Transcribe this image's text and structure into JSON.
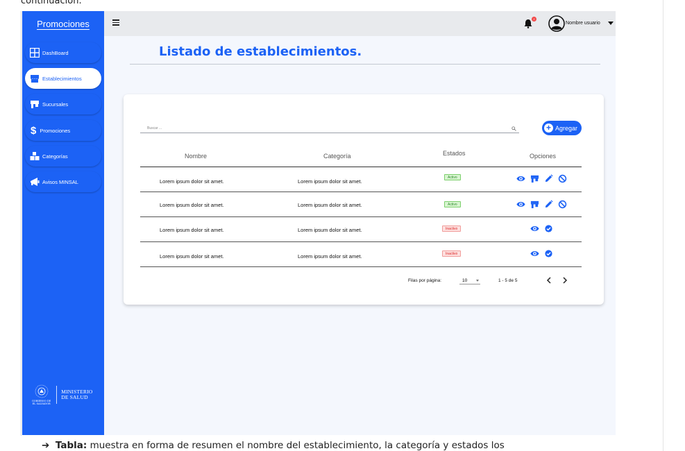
{
  "document": {
    "top_text": "continuación.",
    "bottom_bullet": "➔",
    "bottom_bold": "Tabla:",
    "bottom_text": " muestra en forma de resumen el nombre del establecimiento, la categoría y estados los"
  },
  "sidebar": {
    "brand": "Promociones",
    "items": [
      {
        "label": "DashBoard",
        "icon": "grid-icon",
        "active": false
      },
      {
        "label": "Establecimientos",
        "icon": "store-icon",
        "active": true
      },
      {
        "label": "Sucursales",
        "icon": "shop-icon",
        "active": false
      },
      {
        "label": "Promociones",
        "icon": "dollar-icon",
        "active": false
      },
      {
        "label": "Categorías",
        "icon": "boxes-icon",
        "active": false
      },
      {
        "label": "Avisos MINSAL",
        "icon": "megaphone-icon",
        "active": false
      }
    ],
    "footer": {
      "seal_caption_1": "GOBIERNO DE",
      "seal_caption_2": "EL SALVADOR",
      "ministry_line_1": "MINISTERIO",
      "ministry_line_2": "DE SALUD"
    }
  },
  "topbar": {
    "user_name": "Nombre usuario",
    "notification_badge": "2"
  },
  "page": {
    "title": "Listado de establecimientos."
  },
  "table": {
    "search_placeholder": "Buscar ...",
    "add_button": "Agregar",
    "columns": [
      "Nombre",
      "Categoría",
      "Estados",
      "Opciones"
    ],
    "rows": [
      {
        "nombre": "Lorem ipsum dolor sit amet.",
        "categoria": "Lorem ipsum dolor sit amet.",
        "estado": "Activo",
        "status_color": "#2a8a2a",
        "options": [
          "eye-icon",
          "store-icon",
          "pencil-icon",
          "ban-icon"
        ]
      },
      {
        "nombre": "Lorem ipsum dolor sit amet.",
        "categoria": "Lorem ipsum dolor sit amet.",
        "estado": "Activo",
        "status_color": "#2a8a2a",
        "options": [
          "eye-icon",
          "store-icon",
          "pencil-icon",
          "ban-icon"
        ]
      },
      {
        "nombre": "Lorem ipsum dolor sit amet.",
        "categoria": "Lorem ipsum dolor sit amet.",
        "estado": "Inactivo",
        "status_color": "#dd2222",
        "options": [
          "eye-icon",
          "check-circle-icon"
        ]
      },
      {
        "nombre": "Lorem ipsum dolor sit amet.",
        "categoria": "Lorem ipsum dolor sit amet.",
        "estado": "Inactivo",
        "status_color": "#dd2222",
        "options": [
          "eye-icon",
          "check-circle-icon"
        ]
      }
    ],
    "pagination": {
      "rows_per_page_label": "Filas por página:",
      "rows_per_page_value": "10",
      "range_text": "1 - 5 de 5"
    }
  },
  "colors": {
    "accent": "#1c62f5",
    "topbar": "#e8eaed",
    "content_bg": "#f4f7fd"
  }
}
